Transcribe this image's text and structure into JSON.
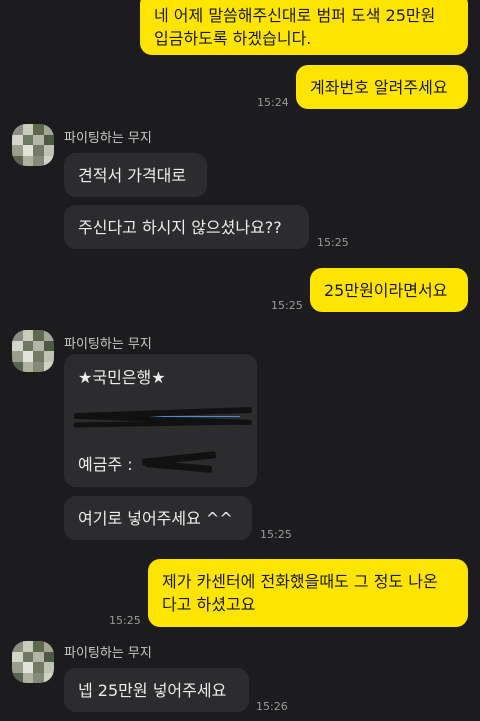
{
  "messages": {
    "m1_line1": "네 어제 말씀해주신대로 범퍼 도색 25만원",
    "m1_line2": "입금하도록 하겠습니다.",
    "m2": "계좌번호 알려주세요",
    "t1": "15:24",
    "sender1": "파이팅하는 무지",
    "m3": "견적서 가격대로",
    "m4": "주신다고 하시지 않으셨나요??",
    "t2": "15:25",
    "m5": "25만원이라면서요",
    "t3": "15:25",
    "sender2": "파이팅하는 무지",
    "m6_title": "★국민은행★",
    "m6_holder": "예금주 :",
    "m7": "여기로 넣어주세요 ^^",
    "t4": "15:25",
    "m8_line1": "제가 카센터에 전화했을때도 그 정도 나온",
    "m8_line2": "다고 하셨고요",
    "t5": "15:25",
    "sender3": "파이팅하는 무지",
    "m9": "넵 25만원 넣어주세요",
    "t6": "15:26"
  },
  "colors": {
    "background": "#1c1c1e",
    "my_bubble": "#fee500",
    "their_bubble": "#2c2c2e"
  }
}
